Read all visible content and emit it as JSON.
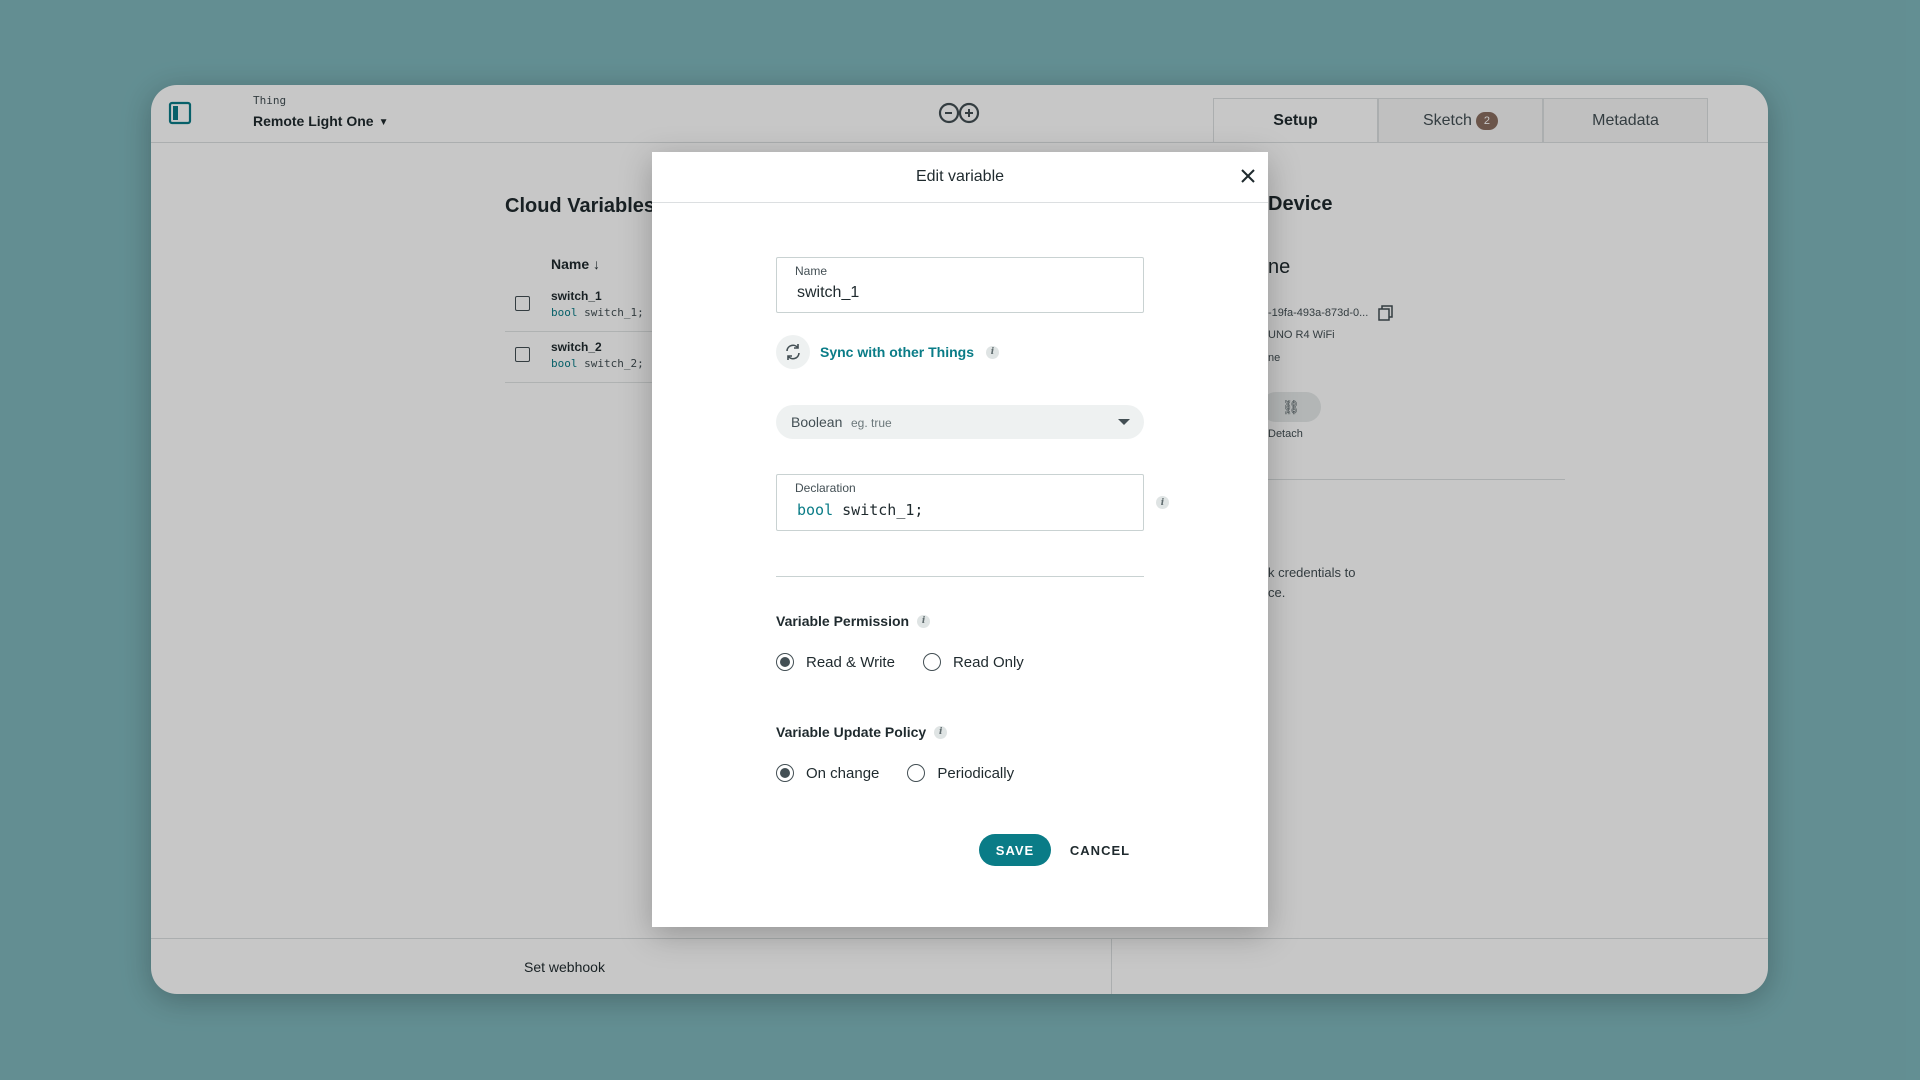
{
  "header": {
    "thing_label": "Thing",
    "thing_name": "Remote Light One",
    "tabs": [
      {
        "label": "Setup",
        "active": true
      },
      {
        "label": "Sketch",
        "badge": "2"
      },
      {
        "label": "Metadata"
      }
    ]
  },
  "background": {
    "cloud_variables_title": "Cloud Variables",
    "name_column": "Name",
    "variables": [
      {
        "name": "switch_1",
        "type": "bool",
        "decl": "switch_1;"
      },
      {
        "name": "switch_2",
        "type": "bool",
        "decl": "switch_2;"
      }
    ],
    "device_title": "Device",
    "device_name_partial": "ne",
    "device_id_partial": "-19fa-493a-873d-0...",
    "device_board_partial": "UNO R4 WiFi",
    "device_status_partial": "ne",
    "detach_label": "Detach",
    "network_text_line1": "k credentials to",
    "network_text_line2": "ce.",
    "set_webhook": "Set webhook"
  },
  "modal": {
    "title": "Edit variable",
    "name_label": "Name",
    "name_value": "switch_1",
    "sync_label": "Sync with other Things",
    "type_name": "Boolean",
    "type_hint": "eg. true",
    "declaration_label": "Declaration",
    "declaration_keyword": "bool",
    "declaration_rest": "switch_1;",
    "permission_title": "Variable Permission",
    "permission_options": [
      "Read & Write",
      "Read Only"
    ],
    "permission_selected": "Read & Write",
    "policy_title": "Variable Update Policy",
    "policy_options": [
      "On change",
      "Periodically"
    ],
    "policy_selected": "On change",
    "save_label": "SAVE",
    "cancel_label": "CANCEL"
  },
  "colors": {
    "accent": "#0a7c87",
    "page_background": "#7fb7bc",
    "badge": "#8a6d5f"
  },
  "icons": {
    "sidebar_toggle": "sidebar-toggle-icon",
    "logo": "arduino-infinity-logo",
    "copy": "copy-icon",
    "close": "close-icon",
    "sync": "sync-icon",
    "info": "info-icon",
    "unlink": "unlink-icon"
  }
}
